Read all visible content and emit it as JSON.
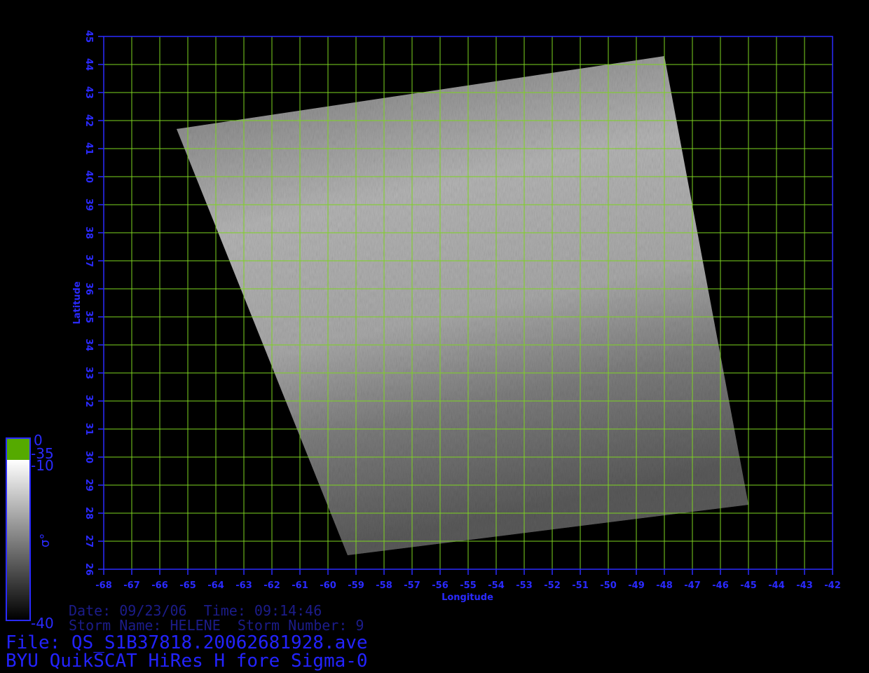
{
  "map": {
    "lon_range": [
      -68,
      -42
    ],
    "lat_range": [
      26,
      45
    ],
    "lon_ticks": [
      "-68",
      "-67",
      "-66",
      "-65",
      "-64",
      "-63",
      "-62",
      "-61",
      "-60",
      "-59",
      "-58",
      "-57",
      "-56",
      "-55",
      "-54",
      "-53",
      "-52",
      "-51",
      "-50",
      "-49",
      "-48",
      "-47",
      "-46",
      "-45",
      "-44",
      "-43",
      "-42"
    ],
    "lat_ticks": [
      "26",
      "27",
      "28",
      "29",
      "30",
      "31",
      "32",
      "33",
      "34",
      "35",
      "36",
      "37",
      "38",
      "39",
      "40",
      "41",
      "42",
      "43",
      "44",
      "45"
    ],
    "xlabel": "Longitude",
    "ylabel": "Latitude",
    "grid": true,
    "grid_color": "#7dd321",
    "axis_color": "#2a2aff",
    "swath_corners_lonlat": [
      [
        -65.4,
        41.7
      ],
      [
        -48.0,
        44.3
      ],
      [
        -45.0,
        28.3
      ],
      [
        -59.3,
        26.5
      ]
    ]
  },
  "colorbar": {
    "labels": [
      "0",
      "-35",
      "-10",
      "σ°",
      "-40"
    ],
    "land_color": "#55aa00",
    "gradient_top": "#ffffff",
    "gradient_bottom": "#000000"
  },
  "info": {
    "date_line": "Date: 09/23/06  Time: 09:14:46",
    "storm_line": "Storm Name: HELENE  Storm Number: 9",
    "file_line": "File: QS_S1B37818.20062681928.ave",
    "product_line": "BYU QuikSCAT HiRes H fore Sigma-0"
  }
}
